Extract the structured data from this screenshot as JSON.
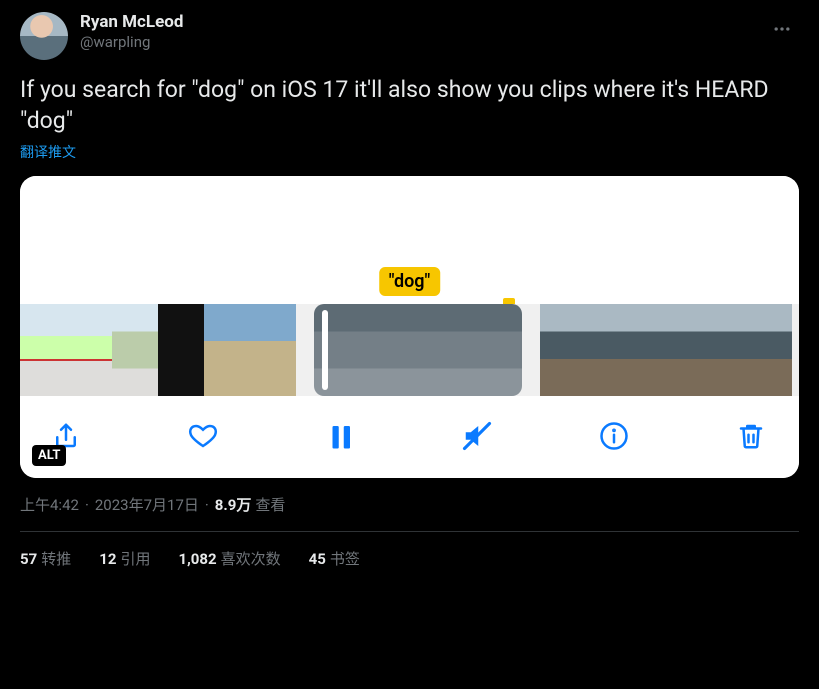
{
  "author": {
    "display_name": "Ryan McLeod",
    "handle": "@warpling"
  },
  "tweet_text": "If you search for \"dog\" on iOS 17 it'll also show you clips where it's HEARD \"dog\"",
  "translate_label": "翻译推文",
  "media": {
    "caption": "\"dog\"",
    "alt_badge": "ALT"
  },
  "meta": {
    "time": "上午4:42",
    "date": "2023年7月17日",
    "views_count": "8.9万",
    "views_label": "查看"
  },
  "stats": {
    "retweets_count": "57",
    "retweets_label": "转推",
    "quotes_count": "12",
    "quotes_label": "引用",
    "likes_count": "1,082",
    "likes_label": "喜欢次数",
    "bookmarks_count": "45",
    "bookmarks_label": "书签"
  }
}
